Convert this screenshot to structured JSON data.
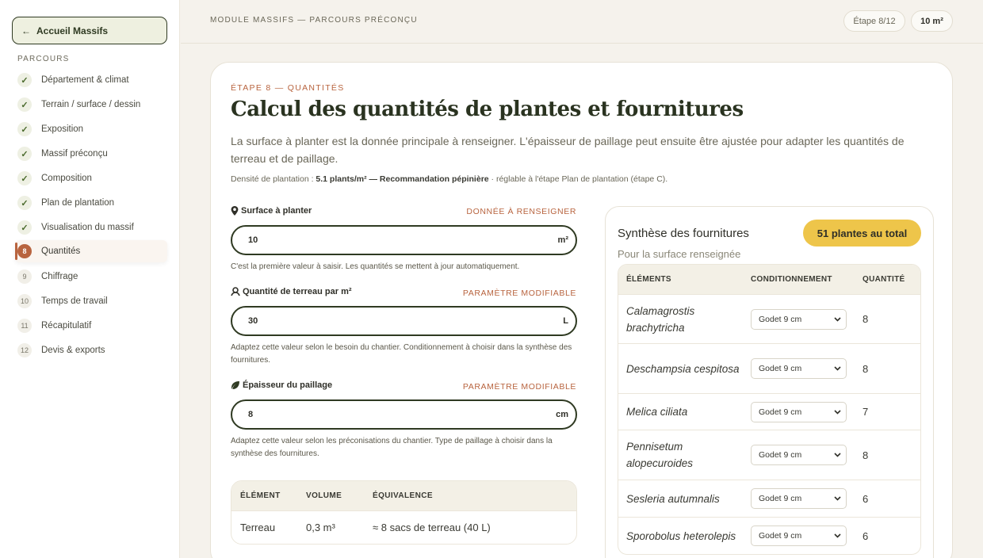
{
  "sidebar": {
    "home_label": "Accueil Massifs",
    "section_label": "PARCOURS",
    "items": [
      {
        "badge": "✓",
        "label": "Département & climat",
        "state": "done"
      },
      {
        "badge": "✓",
        "label": "Terrain / surface / dessin",
        "state": "done"
      },
      {
        "badge": "✓",
        "label": "Exposition",
        "state": "done"
      },
      {
        "badge": "✓",
        "label": "Massif préconçu",
        "state": "done"
      },
      {
        "badge": "✓",
        "label": "Composition",
        "state": "done"
      },
      {
        "badge": "✓",
        "label": "Plan de plantation",
        "state": "done"
      },
      {
        "badge": "✓",
        "label": "Visualisation du massif",
        "state": "done"
      },
      {
        "badge": "8",
        "label": "Quantités",
        "state": "current"
      },
      {
        "badge": "9",
        "label": "Chiffrage",
        "state": "todo"
      },
      {
        "badge": "10",
        "label": "Temps de travail",
        "state": "todo"
      },
      {
        "badge": "11",
        "label": "Récapitulatif",
        "state": "todo"
      },
      {
        "badge": "12",
        "label": "Devis & exports",
        "state": "todo"
      }
    ]
  },
  "topbar": {
    "breadcrumb": "MODULE MASSIFS — PARCOURS PRÉCONÇU",
    "step": "Étape 8/12",
    "area": "10 m²"
  },
  "main": {
    "eyebrow": "ÉTAPE 8 — QUANTITÉS",
    "title": "Calcul des quantités de plantes et fournitures",
    "lead": "La surface à planter est la donnée principale à renseigner. L'épaisseur de paillage peut ensuite être ajustée pour adapter les quantités de terreau et de paillage.",
    "density_prefix": "Densité de plantation : ",
    "density_value": "5.1 plants/m² — Recommandation pépinière",
    "density_suffix": " · réglable à l'étape Plan de plantation (étape C).",
    "fields": {
      "surface": {
        "label": "Surface à planter",
        "tag": "DONNÉE À RENSEIGNER",
        "value": "10",
        "unit": "m²",
        "help": "C'est la première valeur à saisir. Les quantités se mettent à jour automatiquement."
      },
      "terreau": {
        "label": "Quantité de terreau par m²",
        "tag": "PARAMÈTRE MODIFIABLE",
        "value": "30",
        "unit": "L",
        "help": "Adaptez cette valeur selon le besoin du chantier. Conditionnement à choisir dans la synthèse des fournitures."
      },
      "paillage": {
        "label": "Épaisseur du paillage",
        "tag": "PARAMÈTRE MODIFIABLE",
        "value": "8",
        "unit": "cm",
        "help": "Adaptez cette valeur selon les préconisations du chantier. Type de paillage à choisir dans la synthèse des fournitures."
      }
    },
    "volume_table": {
      "headers": [
        "ÉLÉMENT",
        "VOLUME",
        "ÉQUIVALENCE"
      ],
      "rows": [
        [
          "Terreau",
          "0,3 m³",
          "≈ 8 sacs de terreau (40 L)"
        ]
      ]
    }
  },
  "synthesis": {
    "title": "Synthèse des fournitures",
    "subtitle": "Pour la surface renseignée",
    "total": "51 plantes au total",
    "headers": [
      "ÉLÉMENTS",
      "CONDITIONNEMENT",
      "QUANTITÉ"
    ],
    "rows": [
      {
        "name": "Calamagrostis brachytricha",
        "pack": "Godet 9 cm",
        "qty": "8"
      },
      {
        "name": "Deschampsia cespitosa",
        "pack": "Godet 9 cm",
        "qty": "8"
      },
      {
        "name": "Melica ciliata",
        "pack": "Godet 9 cm",
        "qty": "7"
      },
      {
        "name": "Pennisetum alopecuroides",
        "pack": "Godet 9 cm",
        "qty": "8"
      },
      {
        "name": "Sesleria autumnalis",
        "pack": "Godet 9 cm",
        "qty": "6"
      },
      {
        "name": "Sporobolus heterolepis",
        "pack": "Godet 9 cm",
        "qty": "6"
      }
    ]
  }
}
